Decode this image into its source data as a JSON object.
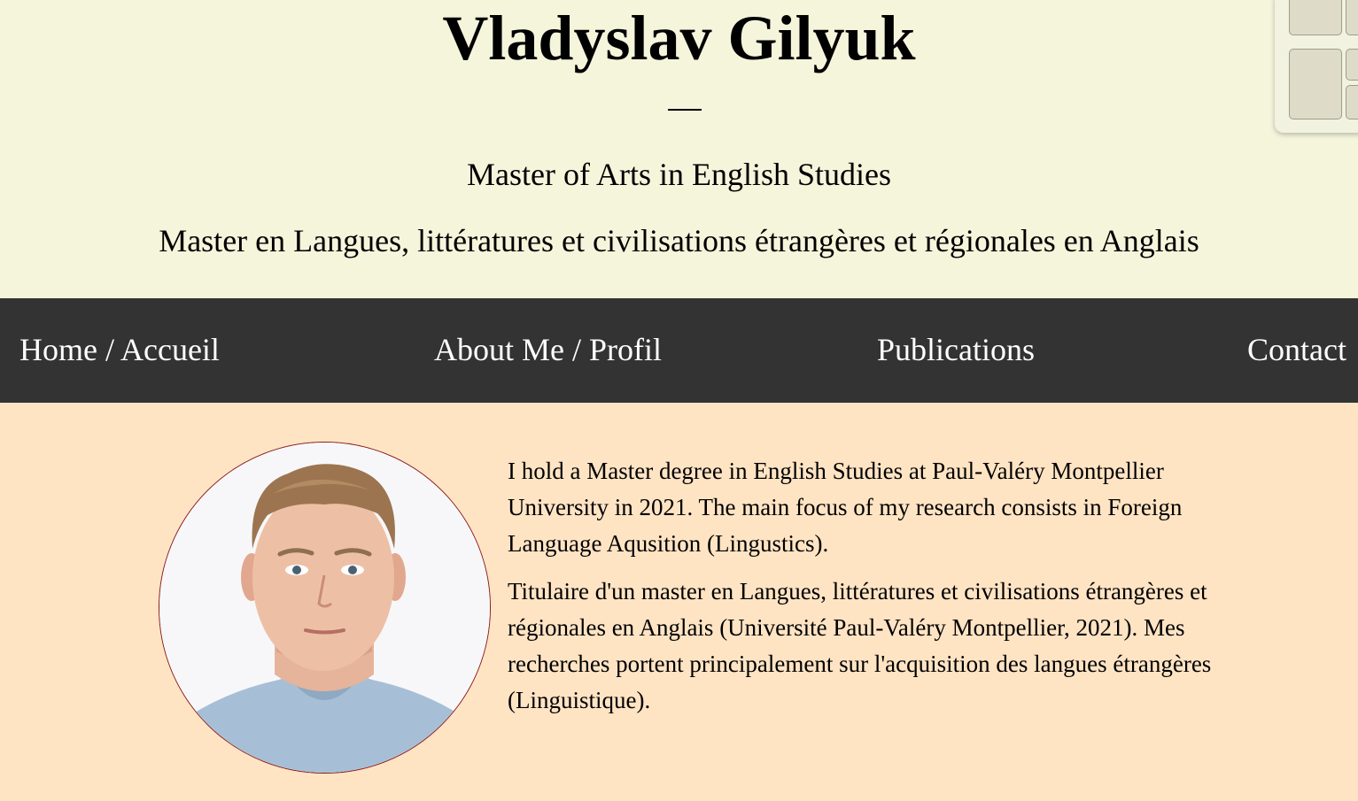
{
  "header": {
    "title": "Vladyslav Gilyuk",
    "subtitle_en": "Master of Arts in English Studies",
    "subtitle_fr": "Master en Langues, littératures et civilisations étrangères et régionales en Anglais"
  },
  "nav": {
    "items": [
      {
        "label": "Home / Accueil"
      },
      {
        "label": "About Me / Profil"
      },
      {
        "label": "Publications"
      },
      {
        "label": "Contact"
      }
    ]
  },
  "main": {
    "bio_en": "I hold a Master degree in English Studies at Paul-Valéry Montpellier University in 2021. The main focus of my research consists in Foreign Language Aqusition (Lingustics).",
    "bio_fr": "Titulaire d'un master en Langues, littératures et civilisations étrangères et régionales en Anglais (Université Paul-Valéry Montpellier, 2021). Mes recherches portent principalement sur l'acquisition des langues étrangères (Linguistique)."
  },
  "colors": {
    "header_bg": "#f5f5dc",
    "nav_bg": "#333333",
    "nav_text": "#ffffff",
    "main_bg": "#ffe4c4",
    "photo_border": "#8b1a1a"
  }
}
